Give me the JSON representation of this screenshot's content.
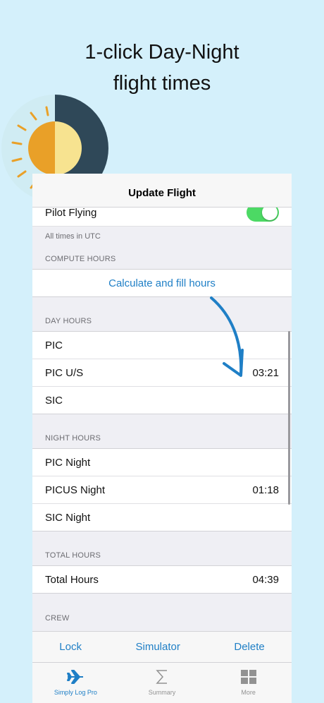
{
  "headline": {
    "line1": "1-click Day-Night",
    "line2": "flight times"
  },
  "colors": {
    "accent": "#1f7fc6",
    "toggle_on": "#4cd964",
    "sun": "#e9a028",
    "sun_light": "#f7e390",
    "night": "#2f4858"
  },
  "navbar": {
    "title": "Update Flight"
  },
  "pilot_flying": {
    "label": "Pilot Flying",
    "enabled": true
  },
  "utc_note": "All times in UTC",
  "compute": {
    "header": "COMPUTE HOURS",
    "action": "Calculate and fill hours"
  },
  "day_hours": {
    "header": "DAY HOURS",
    "rows": [
      {
        "label": "PIC",
        "value": ""
      },
      {
        "label": "PIC U/S",
        "value": "03:21"
      },
      {
        "label": "SIC",
        "value": ""
      }
    ]
  },
  "night_hours": {
    "header": "NIGHT HOURS",
    "rows": [
      {
        "label": "PIC Night",
        "value": ""
      },
      {
        "label": "PICUS Night",
        "value": "01:18"
      },
      {
        "label": "SIC Night",
        "value": ""
      }
    ]
  },
  "total_hours": {
    "header": "TOTAL HOURS",
    "rows": [
      {
        "label": "Total Hours",
        "value": "04:39"
      }
    ]
  },
  "crew": {
    "header": "CREW"
  },
  "toolbar": {
    "lock": "Lock",
    "simulator": "Simulator",
    "delete": "Delete"
  },
  "tabs": [
    {
      "label": "Simply Log Pro",
      "icon": "airplane-icon",
      "active": true
    },
    {
      "label": "Summary",
      "icon": "sigma-icon",
      "active": false
    },
    {
      "label": "More",
      "icon": "grid-icon",
      "active": false
    }
  ]
}
